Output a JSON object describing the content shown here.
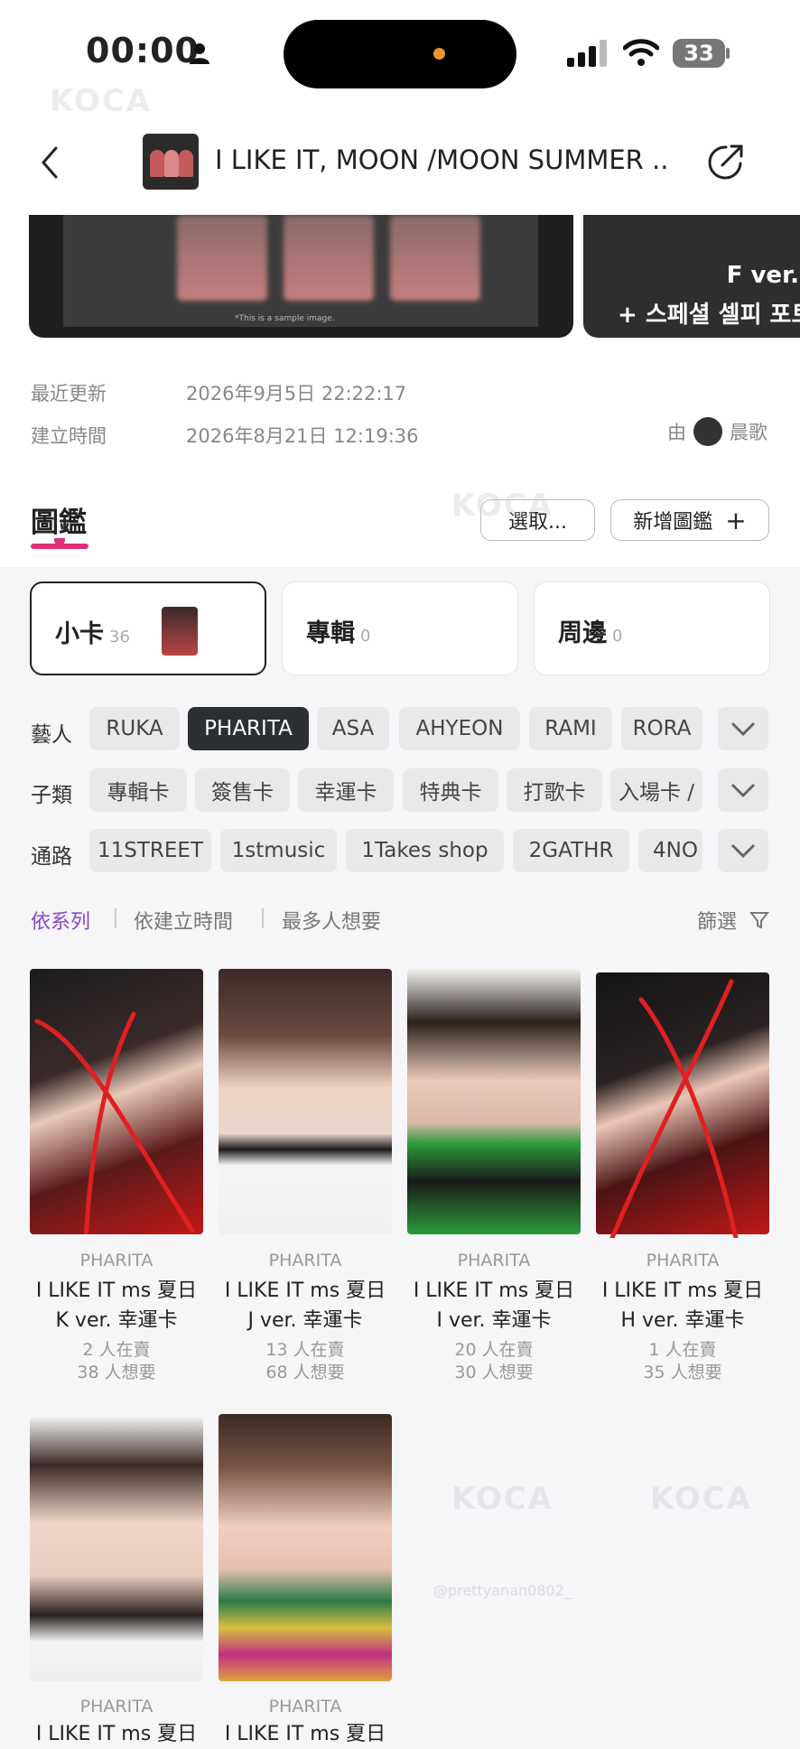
{
  "status_bar": {
    "time": "00:00",
    "battery": "33"
  },
  "header": {
    "title": "I LIKE IT, MOON /MOON SUMMER ..."
  },
  "banner": {
    "right_line1": "F ver. (",
    "right_line2": "+ 스페셜 셀피 포토",
    "sample_note": "*This is a sample image."
  },
  "info": {
    "updated_label": "最近更新",
    "updated_value": "2026年9月5日 22:22:17",
    "created_label": "建立時間",
    "created_value": "2026年8月21日 12:19:36",
    "creator_prefix": "由",
    "creator_name": "晨歌"
  },
  "section": {
    "title": "圖鑑",
    "select_button": "選取...",
    "add_button": "新增圖鑑",
    "add_icon": "+"
  },
  "categories": [
    {
      "label": "小卡",
      "count": "36"
    },
    {
      "label": "專輯",
      "count": "0"
    },
    {
      "label": "周邊",
      "count": "0"
    }
  ],
  "filters": {
    "artist_label": "藝人",
    "artists": [
      "RUKA",
      "PHARITA",
      "ASA",
      "AHYEON",
      "RAMI",
      "RORA"
    ],
    "selected_artist": "PHARITA",
    "subtype_label": "子類",
    "subtypes": [
      "專輯卡",
      "簽售卡",
      "幸運卡",
      "特典卡",
      "打歌卡",
      "入場卡 /"
    ],
    "channel_label": "通路",
    "channels": [
      "11STREET",
      "1stmusic",
      "1Takes shop",
      "2GATHR",
      "4NO"
    ]
  },
  "sort": {
    "options": [
      "依系列",
      "依建立時間",
      "最多人想要"
    ],
    "selected": "依系列",
    "filter_label": "篩選"
  },
  "cards": [
    {
      "artist": "PHARITA",
      "name1": "I LIKE IT ms 夏日",
      "name2": "K ver. 幸運卡",
      "selling": "2 人在賣",
      "wanted": "38 人想要",
      "crossed": true
    },
    {
      "artist": "PHARITA",
      "name1": "I LIKE IT ms 夏日",
      "name2": "J ver. 幸運卡",
      "selling": "13 人在賣",
      "wanted": "68 人想要",
      "crossed": false
    },
    {
      "artist": "PHARITA",
      "name1": "I LIKE IT ms 夏日",
      "name2": "I ver. 幸運卡",
      "selling": "20 人在賣",
      "wanted": "30 人想要",
      "crossed": false
    },
    {
      "artist": "PHARITA",
      "name1": "I LIKE IT ms 夏日",
      "name2": "H ver. 幸運卡",
      "selling": "1 人在賣",
      "wanted": "35 人想要",
      "crossed": true
    },
    {
      "artist": "PHARITA",
      "name1": "I LIKE IT ms 夏日",
      "crossed": false
    },
    {
      "artist": "PHARITA",
      "name1": "I LIKE IT ms 夏日",
      "crossed": false
    }
  ],
  "watermark": {
    "logo": "KOCA",
    "handle": "@prettyanan0802_"
  },
  "colors": {
    "accent_purple": "#8a46c9",
    "accent_pink": "#e0307a",
    "chip_selected": "#2c2f33",
    "cross_red": "#e02020"
  }
}
